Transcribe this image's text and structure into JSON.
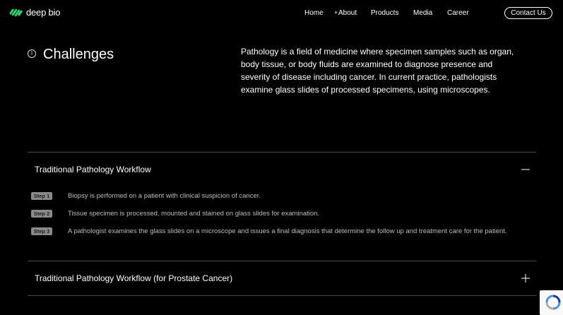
{
  "header": {
    "logo_text": "deep bio",
    "nav": [
      "Home",
      "About",
      "Products",
      "Media",
      "Career"
    ],
    "active_nav": "About",
    "contact_label": "Contact Us"
  },
  "challenges": {
    "number": "1",
    "title": "Challenges",
    "description": "Pathology is a field of medicine where specimen samples such as organ, body tissue, or body fluids are examined to diagnose presence and severity of disease including cancer. In current practice, pathologists examine glass slides of processed specimens, using microscopes."
  },
  "accordion": [
    {
      "title": "Traditional Pathology Workflow",
      "expanded": true,
      "steps": [
        {
          "label": "Step 1",
          "text": "Biopsy is performed on a patient with clinical suspicion of cancer."
        },
        {
          "label": "Step 2",
          "text": "Tissue specimen is processed, mounted and stained on glass slides for examination."
        },
        {
          "label": "Step 3",
          "text": "A pathologist examines the glass slides on a microscope and issues a final diagnosis that determine the follow up and treatment care for the patient."
        }
      ]
    },
    {
      "title": "Traditional Pathology Workflow (for Prostate Cancer)",
      "expanded": false
    }
  ],
  "colors": {
    "background": "#000000",
    "accent": "#2fd36b",
    "divider": "#4a4a4a",
    "badge": "#8a8a8a"
  }
}
